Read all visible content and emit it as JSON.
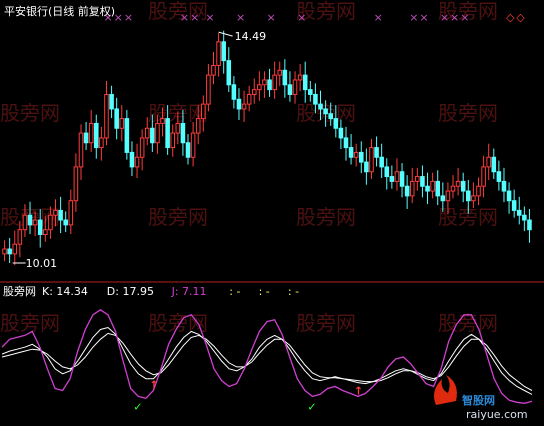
{
  "chart_data": [
    {
      "type": "candlestick",
      "title": "平安银行(日线 前复权)",
      "high_label": "14.49",
      "low_label": "10.01",
      "ylim": [
        9.6,
        14.9
      ],
      "up_color": "#ff3c3c",
      "down_color": "#55ffff",
      "signal_marks": [
        "×",
        "◇"
      ],
      "series": [
        {
          "name": "price",
          "values": [
            10.2,
            10.1,
            10.3,
            10.6,
            10.9,
            10.7,
            10.8,
            10.5,
            10.6,
            10.9,
            11.0,
            10.8,
            10.7,
            11.2,
            11.9,
            12.6,
            12.4,
            12.8,
            12.3,
            12.5,
            13.4,
            13.1,
            12.7,
            12.9,
            12.2,
            11.9,
            12.1,
            12.5,
            12.7,
            12.4,
            12.8,
            12.9,
            12.3,
            12.6,
            12.8,
            12.4,
            12.1,
            12.6,
            12.9,
            13.2,
            13.8,
            14.0,
            14.49,
            14.1,
            13.6,
            13.3,
            13.1,
            13.2,
            13.4,
            13.5,
            13.6,
            13.7,
            13.5,
            13.8,
            13.9,
            13.6,
            13.4,
            13.7,
            13.8,
            13.5,
            13.4,
            13.2,
            13.1,
            13.0,
            12.9,
            12.7,
            12.5,
            12.3,
            12.1,
            12.2,
            12.0,
            11.8,
            12.3,
            12.1,
            11.9,
            11.7,
            11.6,
            11.8,
            11.5,
            11.3,
            11.6,
            11.7,
            11.5,
            11.4,
            11.6,
            11.3,
            11.2,
            11.4,
            11.5,
            11.6,
            11.4,
            11.2,
            11.3,
            11.5,
            11.9,
            12.1,
            11.8,
            11.6,
            11.4,
            11.2,
            11.0,
            10.9,
            10.8,
            10.6
          ]
        }
      ]
    },
    {
      "type": "line",
      "indicator_name": "股旁网",
      "ylim": [
        -10,
        110
      ],
      "legend": [
        {
          "label": "K: 14.34",
          "color": "#ffffff"
        },
        {
          "label": "D: 17.95",
          "color": "#ffffff"
        },
        {
          "label": "J: 7.11",
          "color": "#d040d0"
        },
        {
          "label": ": -",
          "color": "#ffff66"
        },
        {
          "label": ": -",
          "color": "#ffff66"
        },
        {
          "label": ": -",
          "color": "#ffff66"
        }
      ],
      "series": [
        {
          "name": "K",
          "color": "#ffffff",
          "values": [
            55,
            58,
            60,
            62,
            65,
            60,
            52,
            40,
            35,
            38,
            48,
            60,
            72,
            80,
            82,
            75,
            60,
            45,
            35,
            30,
            30,
            38,
            50,
            62,
            72,
            78,
            75,
            68,
            58,
            48,
            40,
            38,
            42,
            50,
            62,
            70,
            74,
            70,
            60,
            48,
            38,
            30,
            28,
            30,
            32,
            30,
            28,
            26,
            25,
            27,
            30,
            34,
            38,
            40,
            38,
            34,
            30,
            28,
            35,
            48,
            60,
            70,
            75,
            70,
            60,
            48,
            36,
            28,
            22,
            18,
            14
          ]
        },
        {
          "name": "D",
          "color": "#ffffff",
          "values": [
            52,
            54,
            56,
            58,
            60,
            59,
            55,
            48,
            42,
            40,
            44,
            52,
            62,
            70,
            76,
            74,
            66,
            55,
            45,
            38,
            34,
            36,
            44,
            54,
            64,
            72,
            74,
            70,
            63,
            54,
            46,
            42,
            42,
            47,
            56,
            64,
            70,
            70,
            64,
            54,
            44,
            36,
            32,
            31,
            31,
            30,
            29,
            28,
            27,
            27,
            28,
            31,
            35,
            38,
            38,
            36,
            32,
            30,
            33,
            42,
            53,
            63,
            70,
            70,
            64,
            54,
            43,
            34,
            28,
            22,
            17.95
          ]
        },
        {
          "name": "J",
          "color": "#d040d0",
          "values": [
            62,
            70,
            72,
            74,
            78,
            62,
            40,
            20,
            18,
            30,
            58,
            80,
            95,
            100,
            95,
            78,
            48,
            20,
            12,
            10,
            18,
            40,
            65,
            80,
            92,
            95,
            85,
            64,
            40,
            28,
            22,
            25,
            40,
            60,
            78,
            88,
            90,
            75,
            52,
            30,
            18,
            12,
            14,
            20,
            22,
            18,
            15,
            12,
            15,
            22,
            30,
            42,
            50,
            52,
            45,
            35,
            25,
            22,
            40,
            68,
            85,
            95,
            95,
            80,
            55,
            30,
            15,
            8,
            6,
            5,
            7.11
          ]
        }
      ],
      "buy_marks": [
        "↑",
        "↑"
      ],
      "trough_marks": [
        "✓",
        "✓"
      ]
    }
  ],
  "watermark": "股旁网",
  "logo": {
    "name": "智股网",
    "url": "raiyue.com"
  }
}
